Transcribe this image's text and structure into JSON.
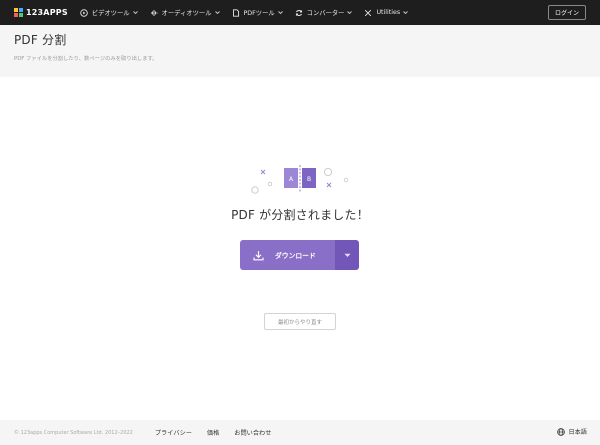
{
  "topbar": {
    "logo_text": "123APPS",
    "nav": [
      {
        "label": "ビデオツール",
        "icon": "video-icon"
      },
      {
        "label": "オーディオツール",
        "icon": "audio-wave-icon"
      },
      {
        "label": "PDFツール",
        "icon": "pdf-file-icon"
      },
      {
        "label": "コンバーター",
        "icon": "convert-icon"
      },
      {
        "label": "Utilities",
        "icon": "utilities-icon"
      }
    ],
    "login_label": "ログイン"
  },
  "header": {
    "title": "PDF 分割",
    "subtitle": "PDF ファイルを分割したり、数ページのみを取り出します。"
  },
  "illustration": {
    "page_a": "A",
    "page_b": "B"
  },
  "result": {
    "title": "PDF が分割されました！",
    "download_label": "ダウンロード",
    "restart_label": "最初からやり直す"
  },
  "footer": {
    "copyright": "© 123apps Computer Software Ltd. 2012–2022",
    "links": [
      "プライバシー",
      "価格",
      "お問い合わせ"
    ],
    "language": "日本語"
  },
  "colors": {
    "accent": "#8a6fc9",
    "accent_dark": "#7256b8",
    "topbar_bg": "#1e1e1e",
    "header_bg": "#f5f5f5"
  }
}
